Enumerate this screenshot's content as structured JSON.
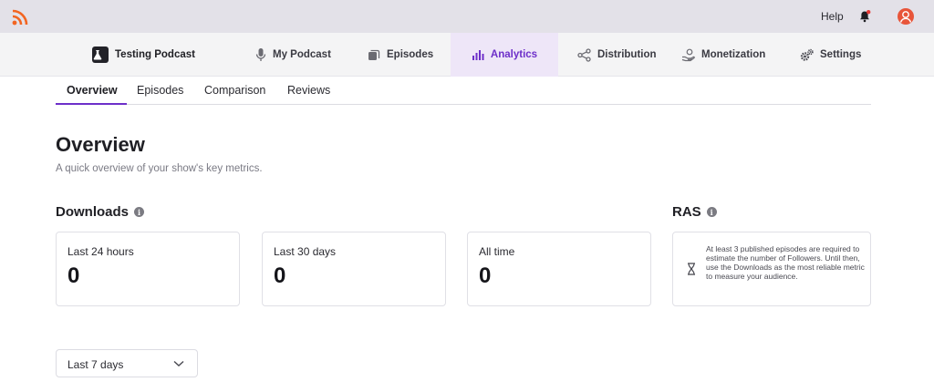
{
  "topbar": {
    "logo_icon": "rss-icon",
    "help_label": "Help",
    "notification_icon": "bell-icon",
    "avatar_icon": "user-avatar-icon"
  },
  "nav": {
    "brand": "Testing Podcast",
    "items": [
      {
        "label": "My Podcast",
        "icon": "microphone-icon"
      },
      {
        "label": "Episodes",
        "icon": "stack-icon"
      },
      {
        "label": "Analytics",
        "icon": "bar-chart-icon",
        "active": true
      },
      {
        "label": "Distribution",
        "icon": "share-icon"
      },
      {
        "label": "Monetization",
        "icon": "hand-coin-icon"
      },
      {
        "label": "Settings",
        "icon": "gears-icon"
      }
    ]
  },
  "subtabs": [
    "Overview",
    "Episodes",
    "Comparison",
    "Reviews"
  ],
  "page": {
    "title": "Overview",
    "subtitle": "A quick overview of your show's key metrics."
  },
  "downloads": {
    "heading": "Downloads",
    "cards": [
      {
        "label": "Last 24 hours",
        "value": "0"
      },
      {
        "label": "Last 30 days",
        "value": "0"
      },
      {
        "label": "All time",
        "value": "0"
      }
    ]
  },
  "ras": {
    "heading": "RAS",
    "message": "At least 3 published episodes are required to estimate the number of Followers. Until then, use the Downloads as the most reliable metric to measure your audience."
  },
  "period_select": {
    "value": "Last 7 days"
  },
  "colors": {
    "accent": "#6d2fc9",
    "topbar_bg": "#e3e1e8",
    "rss_orange": "#f26522",
    "bell_dot": "#e53935"
  }
}
